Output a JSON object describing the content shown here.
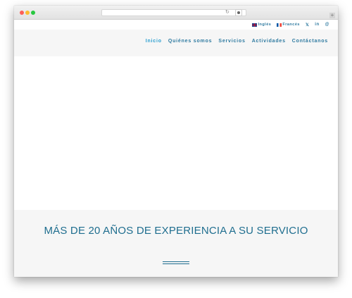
{
  "topbar": {
    "lang_en": "Inglés",
    "lang_fr": "Francés",
    "social": [
      "𝕏",
      "in",
      "@"
    ]
  },
  "nav": {
    "items": [
      "Inicio",
      "Quiénes somos",
      "Servicios",
      "Actividades",
      "Contáctanos"
    ],
    "active": "Inicio"
  },
  "section": {
    "headline": "MÁS DE  20 AÑOS DE EXPERIENCIA A SU SERVICIO"
  },
  "icons": {
    "reload": "reload-icon",
    "extension": "extension-icon",
    "new_tab": "plus-icon"
  },
  "colors": {
    "brand": "#1f6e8f",
    "nav_link": "#2e7aa0",
    "accent": "#1f95c7"
  }
}
